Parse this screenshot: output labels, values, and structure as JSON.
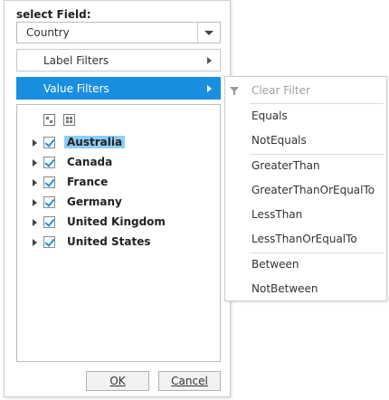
{
  "field_label": "select Field:",
  "field_dropdown": {
    "value": "Country"
  },
  "menu": {
    "label_filters": "Label Filters",
    "value_filters": "Value Filters"
  },
  "tree": {
    "items": [
      {
        "label": "Australia",
        "checked": true,
        "selected": true
      },
      {
        "label": "Canada",
        "checked": true,
        "selected": false
      },
      {
        "label": "France",
        "checked": true,
        "selected": false
      },
      {
        "label": "Germany",
        "checked": true,
        "selected": false
      },
      {
        "label": "United Kingdom",
        "checked": true,
        "selected": false
      },
      {
        "label": "United States",
        "checked": true,
        "selected": false
      }
    ]
  },
  "buttons": {
    "ok": "OK",
    "cancel": "Cancel"
  },
  "submenu": {
    "clear_filter": "Clear Filter",
    "items": [
      "Equals",
      "NotEquals",
      "GreaterThan",
      "GreaterThanOrEqualTo",
      "LessThan",
      "LessThanOrEqualTo",
      "Between",
      "NotBetween"
    ]
  },
  "colors": {
    "accent": "#1a8fe0",
    "selection": "#8ecdf5"
  }
}
